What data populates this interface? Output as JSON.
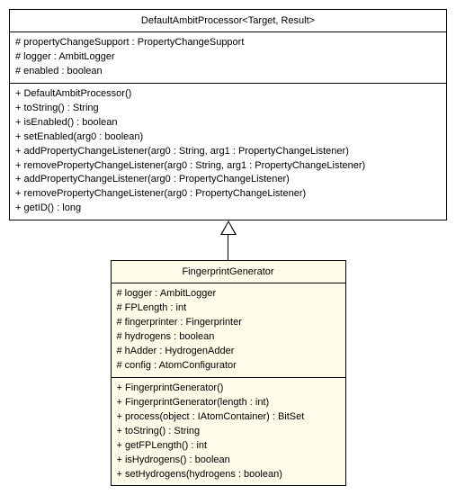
{
  "parent": {
    "name": "DefaultAmbitProcessor<Target, Result>",
    "fields": [
      "# propertyChangeSupport : PropertyChangeSupport",
      "# logger : AmbitLogger",
      "# enabled : boolean"
    ],
    "methods": [
      "+ DefaultAmbitProcessor()",
      "+ toString() : String",
      "+ isEnabled() : boolean",
      "+ setEnabled(arg0 : boolean)",
      "+ addPropertyChangeListener(arg0 : String, arg1 : PropertyChangeListener)",
      "+ removePropertyChangeListener(arg0 : String, arg1 : PropertyChangeListener)",
      "+ addPropertyChangeListener(arg0 : PropertyChangeListener)",
      "+ removePropertyChangeListener(arg0 : PropertyChangeListener)",
      "+ getID() : long"
    ]
  },
  "child": {
    "name": "FingerprintGenerator",
    "fields": [
      "# logger : AmbitLogger",
      "# FPLength : int",
      "# fingerprinter : Fingerprinter",
      "# hydrogens : boolean",
      "# hAdder : HydrogenAdder",
      "# config : AtomConfigurator"
    ],
    "methods": [
      "+ FingerprintGenerator()",
      "+ FingerprintGenerator(length : int)",
      "+ process(object : IAtomContainer) : BitSet",
      "+ toString() : String",
      "+ getFPLength() : int",
      "+ isHydrogens() : boolean",
      "+ setHydrogens(hydrogens : boolean)"
    ]
  }
}
